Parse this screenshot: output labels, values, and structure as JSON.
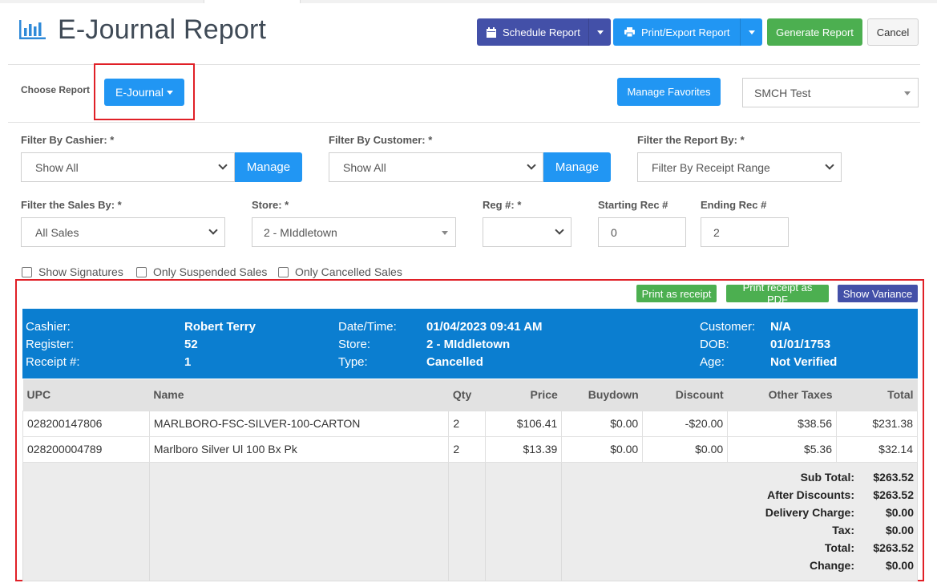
{
  "header": {
    "title": "E-Journal Report",
    "chart_icon": "bar-chart-icon",
    "buttons": {
      "schedule": "Schedule Report",
      "print_export": "Print/Export Report",
      "generate": "Generate Report",
      "cancel": "Cancel"
    }
  },
  "choose": {
    "label": "Choose Report",
    "report_button": "E-Journal",
    "manage_favorites": "Manage Favorites",
    "favorite_select": "SMCH Test"
  },
  "filters": {
    "cashier_label": "Filter By Cashier: *",
    "cashier_value": "Show All",
    "cashier_manage": "Manage",
    "customer_label": "Filter By Customer: *",
    "customer_value": "Show All",
    "customer_manage": "Manage",
    "report_by_label": "Filter the Report By: *",
    "report_by_value": "Filter By Receipt Range",
    "sales_by_label": "Filter the Sales By: *",
    "sales_by_value": "All Sales",
    "store_label": "Store: *",
    "store_value": "2 - MIddletown",
    "reg_label": "Reg #: *",
    "reg_value": "",
    "start_label": "Starting Rec #",
    "start_value": "0",
    "end_label": "Ending Rec #",
    "end_value": "2"
  },
  "checkboxes": {
    "signatures": "Show Signatures",
    "suspended": "Only Suspended Sales",
    "cancelled": "Only Cancelled Sales"
  },
  "receipt": {
    "actions": {
      "print_receipt": "Print as receipt",
      "print_pdf": "Print receipt as PDF",
      "variance": "Show Variance"
    },
    "info": {
      "cashier_k": "Cashier:",
      "cashier_v": "Robert Terry",
      "register_k": "Register:",
      "register_v": "52",
      "receipt_k": "Receipt #:",
      "receipt_v": "1",
      "datetime_k": "Date/Time:",
      "datetime_v": "01/04/2023 09:41 AM",
      "store_k": "Store:",
      "store_v": "2 - MIddletown",
      "type_k": "Type:",
      "type_v": "Cancelled",
      "customer_k": "Customer:",
      "customer_v": "N/A",
      "dob_k": "DOB:",
      "dob_v": "01/01/1753",
      "age_k": "Age:",
      "age_v": "Not Verified"
    },
    "columns": [
      "UPC",
      "Name",
      "Qty",
      "Price",
      "Buydown",
      "Discount",
      "Other Taxes",
      "Total"
    ],
    "rows": [
      [
        "028200147806",
        "MARLBORO-FSC-SILVER-100-CARTON",
        "2",
        "$106.41",
        "$0.00",
        "-$20.00",
        "$38.56",
        "$231.38"
      ],
      [
        "028200004789",
        "Marlboro Silver Ul 100 Bx Pk",
        "2",
        "$13.39",
        "$0.00",
        "$0.00",
        "$5.36",
        "$32.14"
      ]
    ],
    "summary": [
      {
        "label": "Sub Total:",
        "value": "$263.52"
      },
      {
        "label": "After Discounts:",
        "value": "$263.52"
      },
      {
        "label": "Delivery Charge:",
        "value": "$0.00"
      },
      {
        "label": "Tax:",
        "value": "$0.00"
      },
      {
        "label": "Total:",
        "value": "$263.52"
      },
      {
        "label": "Change:",
        "value": "$0.00"
      }
    ]
  },
  "colors": {
    "purple": "#4350a8",
    "blue": "#2196f3",
    "green": "#4caf50",
    "info_blue": "#0b7ed0",
    "highlight_red": "#e02027"
  }
}
